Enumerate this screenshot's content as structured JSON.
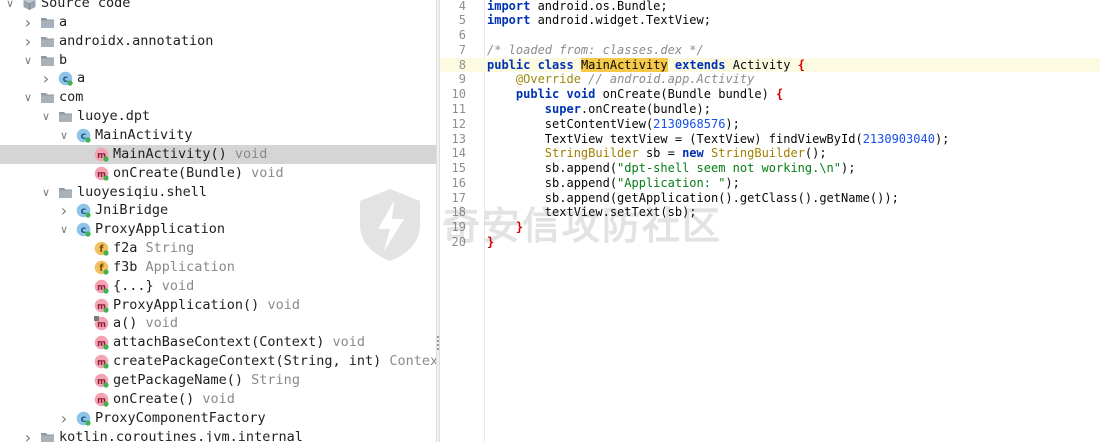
{
  "tree": {
    "rows": [
      {
        "label": "Source code",
        "type": "",
        "icon": "source-code-icon",
        "depth": 1,
        "arrow": "down"
      },
      {
        "label": "a",
        "type": "",
        "icon": "package-icon",
        "depth": 2,
        "arrow": "right"
      },
      {
        "label": "androidx.annotation",
        "type": "",
        "icon": "package-icon",
        "depth": 2,
        "arrow": "right"
      },
      {
        "label": "b",
        "type": "",
        "icon": "package-icon",
        "depth": 2,
        "arrow": "down"
      },
      {
        "label": "a",
        "type": "",
        "icon": "class-icon",
        "depth": 3,
        "arrow": "right"
      },
      {
        "label": "com",
        "type": "",
        "icon": "package-icon",
        "depth": 2,
        "arrow": "down"
      },
      {
        "label": "luoye.dpt",
        "type": "",
        "icon": "package-icon",
        "depth": 3,
        "arrow": "down"
      },
      {
        "label": "MainActivity",
        "type": "",
        "icon": "class-icon",
        "depth": 4,
        "arrow": "down"
      },
      {
        "label": "MainActivity()",
        "type": "void",
        "icon": "method-icon",
        "depth": 5,
        "arrow": "",
        "selected": true
      },
      {
        "label": "onCreate(Bundle)",
        "type": "void",
        "icon": "method-icon",
        "depth": 5,
        "arrow": ""
      },
      {
        "label": "luoyesiqiu.shell",
        "type": "",
        "icon": "package-icon",
        "depth": 3,
        "arrow": "down"
      },
      {
        "label": "JniBridge",
        "type": "",
        "icon": "class-icon",
        "depth": 4,
        "arrow": "right"
      },
      {
        "label": "ProxyApplication",
        "type": "",
        "icon": "class-icon",
        "depth": 4,
        "arrow": "down"
      },
      {
        "label": "f2a",
        "type": "String",
        "icon": "field-icon",
        "depth": 5,
        "arrow": ""
      },
      {
        "label": "f3b",
        "type": "Application",
        "icon": "field-icon",
        "depth": 5,
        "arrow": ""
      },
      {
        "label": "{...}",
        "type": "void",
        "icon": "method-icon",
        "depth": 5,
        "arrow": ""
      },
      {
        "label": "ProxyApplication()",
        "type": "void",
        "icon": "method-icon",
        "depth": 5,
        "arrow": ""
      },
      {
        "label": "a()",
        "type": "void",
        "icon": "private-method-icon",
        "depth": 5,
        "arrow": ""
      },
      {
        "label": "attachBaseContext(Context)",
        "type": "void",
        "icon": "method-icon",
        "depth": 5,
        "arrow": ""
      },
      {
        "label": "createPackageContext(String, int)",
        "type": "Context",
        "icon": "method-icon",
        "depth": 5,
        "arrow": ""
      },
      {
        "label": "getPackageName()",
        "type": "String",
        "icon": "method-icon",
        "depth": 5,
        "arrow": ""
      },
      {
        "label": "onCreate()",
        "type": "void",
        "icon": "method-icon",
        "depth": 5,
        "arrow": ""
      },
      {
        "label": "ProxyComponentFactory",
        "type": "",
        "icon": "class-icon",
        "depth": 4,
        "arrow": "right"
      },
      {
        "label": "kotlin.coroutines.jvm.internal",
        "type": "",
        "icon": "package-icon",
        "depth": 2,
        "arrow": "right"
      }
    ]
  },
  "editor": {
    "current_line": 8,
    "lines": [
      {
        "n": "4",
        "tokens": [
          {
            "t": "import",
            "k": "kw"
          },
          {
            "t": " android.os.Bundle;",
            "k": "plain"
          }
        ]
      },
      {
        "n": "5",
        "tokens": [
          {
            "t": "import",
            "k": "kw"
          },
          {
            "t": " android.widget.TextView;",
            "k": "plain"
          }
        ]
      },
      {
        "n": "6",
        "tokens": []
      },
      {
        "n": "7",
        "tokens": [
          {
            "t": "/* loaded from: classes.dex */",
            "k": "comment"
          }
        ]
      },
      {
        "n": "8",
        "tokens": [
          {
            "t": "public",
            "k": "kw"
          },
          {
            "t": " ",
            "k": "plain"
          },
          {
            "t": "class",
            "k": "kw"
          },
          {
            "t": " ",
            "k": "plain"
          },
          {
            "t": "MainActivity",
            "k": "hl"
          },
          {
            "t": " ",
            "k": "plain"
          },
          {
            "t": "extends",
            "k": "kw"
          },
          {
            "t": " Activity ",
            "k": "plain"
          },
          {
            "t": "{",
            "k": "brace"
          }
        ]
      },
      {
        "n": "9",
        "tokens": [
          {
            "t": "    ",
            "k": "plain"
          },
          {
            "t": "@Override",
            "k": "anno"
          },
          {
            "t": " ",
            "k": "plain"
          },
          {
            "t": "// android.app.Activity",
            "k": "comment"
          }
        ]
      },
      {
        "n": "10",
        "tokens": [
          {
            "t": "    ",
            "k": "plain"
          },
          {
            "t": "public",
            "k": "kw"
          },
          {
            "t": " ",
            "k": "plain"
          },
          {
            "t": "void",
            "k": "kw"
          },
          {
            "t": " onCreate(Bundle bundle) ",
            "k": "plain"
          },
          {
            "t": "{",
            "k": "brace"
          }
        ]
      },
      {
        "n": "11",
        "tokens": [
          {
            "t": "        ",
            "k": "plain"
          },
          {
            "t": "super",
            "k": "kw"
          },
          {
            "t": ".onCreate(bundle);",
            "k": "plain"
          }
        ]
      },
      {
        "n": "12",
        "tokens": [
          {
            "t": "        setContentView(",
            "k": "plain"
          },
          {
            "t": "2130968576",
            "k": "num"
          },
          {
            "t": ");",
            "k": "plain"
          }
        ]
      },
      {
        "n": "13",
        "tokens": [
          {
            "t": "        TextView textView = (TextView) findViewById(",
            "k": "plain"
          },
          {
            "t": "2130903040",
            "k": "num"
          },
          {
            "t": ");",
            "k": "plain"
          }
        ]
      },
      {
        "n": "14",
        "tokens": [
          {
            "t": "        ",
            "k": "plain"
          },
          {
            "t": "StringBuilder",
            "k": "type"
          },
          {
            "t": " sb = ",
            "k": "plain"
          },
          {
            "t": "new",
            "k": "kw"
          },
          {
            "t": " ",
            "k": "plain"
          },
          {
            "t": "StringBuilder",
            "k": "type"
          },
          {
            "t": "();",
            "k": "plain"
          }
        ]
      },
      {
        "n": "15",
        "tokens": [
          {
            "t": "        sb.append(",
            "k": "plain"
          },
          {
            "t": "\"dpt-shell seem not working.\\n\"",
            "k": "str"
          },
          {
            "t": ");",
            "k": "plain"
          }
        ]
      },
      {
        "n": "16",
        "tokens": [
          {
            "t": "        sb.append(",
            "k": "plain"
          },
          {
            "t": "\"Application: \"",
            "k": "str"
          },
          {
            "t": ");",
            "k": "plain"
          }
        ]
      },
      {
        "n": "17",
        "tokens": [
          {
            "t": "        sb.append(getApplication().getClass().getName());",
            "k": "plain"
          }
        ]
      },
      {
        "n": "18",
        "tokens": [
          {
            "t": "        textView.setText(sb);",
            "k": "plain"
          }
        ]
      },
      {
        "n": "19",
        "tokens": [
          {
            "t": "    ",
            "k": "plain"
          },
          {
            "t": "}",
            "k": "brace"
          }
        ]
      },
      {
        "n": "20",
        "tokens": [
          {
            "t": "}",
            "k": "brace"
          }
        ]
      }
    ]
  },
  "watermark": {
    "text": "奇安信攻防社区"
  },
  "colors": {
    "keyword": "#0033b3",
    "comment": "#8c8c8c",
    "annotation": "#9e880d",
    "number": "#1750eb",
    "string": "#067d17",
    "type": "#a08000",
    "brace": "#d40000",
    "highlight": "#f7c948",
    "selection": "#d5d5d5",
    "current_line": "#fcfae1"
  }
}
